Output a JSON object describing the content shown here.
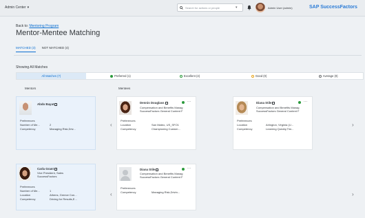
{
  "shell": {
    "home_label": "Admin Center",
    "search_placeholder": "Search for actions or people",
    "user_label": "Admin User (admin)",
    "brand": "SAP SuccessFactors"
  },
  "page": {
    "back_prefix": "Back to:",
    "back_link": "Mentoring Program",
    "title": "Mentor-Mentee Matching",
    "tabs": [
      "MATCHED (3)",
      "NOT MATCHED (4)"
    ],
    "showing": "Showing All Matches",
    "filters": [
      {
        "label": "All Matches (7)",
        "color": ""
      },
      {
        "label": "Preferred (1)",
        "color": "#2b9a3c"
      },
      {
        "label": "Excellent (4)",
        "color": "#2b9a3c"
      },
      {
        "label": "Good (0)",
        "color": "#e8a317"
      },
      {
        "label": "Average (0)",
        "color": "#ffffff"
      }
    ],
    "col_mentors": "Mentors",
    "col_mentees": "Mentees"
  },
  "rows": [
    {
      "mentor": {
        "name": "Abdo Bayat",
        "fields": [
          {
            "k": "Preferences",
            "v": ""
          },
          {
            "k": "Number of Me...",
            "v": "2"
          },
          {
            "k": "Competency",
            "v": "Managing Risk,Driv..."
          }
        ]
      },
      "mentees": [
        {
          "name": "Dennis Douglass",
          "title": "Compensation and Benefits Manag",
          "org": "SuccessFactors General Content F",
          "fields": [
            {
              "k": "Preferences",
              "v": ""
            },
            {
              "k": "Location",
              "v": "San Mateo, US_SFO1"
            },
            {
              "k": "Competency",
              "v": "Championing Custom..."
            }
          ]
        },
        {
          "name": "Diana Stile",
          "title": "Compensation and Benefits Manag",
          "org": "SuccessFactors General Content F",
          "fields": [
            {
              "k": "Preferences",
              "v": ""
            },
            {
              "k": "Location",
              "v": "Arlington, Virginia (U..."
            },
            {
              "k": "Competency",
              "v": "Learning Quickly,Tim..."
            }
          ]
        }
      ]
    },
    {
      "mentor": {
        "name": "Carla Grant",
        "title": "Vice President, Sales",
        "org": "SuccessFactors",
        "fields": [
          {
            "k": "Preferences",
            "v": ""
          },
          {
            "k": "Number of Me...",
            "v": "1"
          },
          {
            "k": "Location",
            "v": "Athens, Greece Con..."
          },
          {
            "k": "Competency",
            "v": "Driving for Results,E..."
          }
        ]
      },
      "mentees": [
        {
          "name": "Diana Stile",
          "title": "Compensation and Benefits Manag",
          "org": "SuccessFactors General Content F",
          "fields": [
            {
              "k": "Preferences",
              "v": ""
            },
            {
              "k": "Competency",
              "v": "Managing Risk,Drivin..."
            }
          ]
        }
      ]
    }
  ]
}
